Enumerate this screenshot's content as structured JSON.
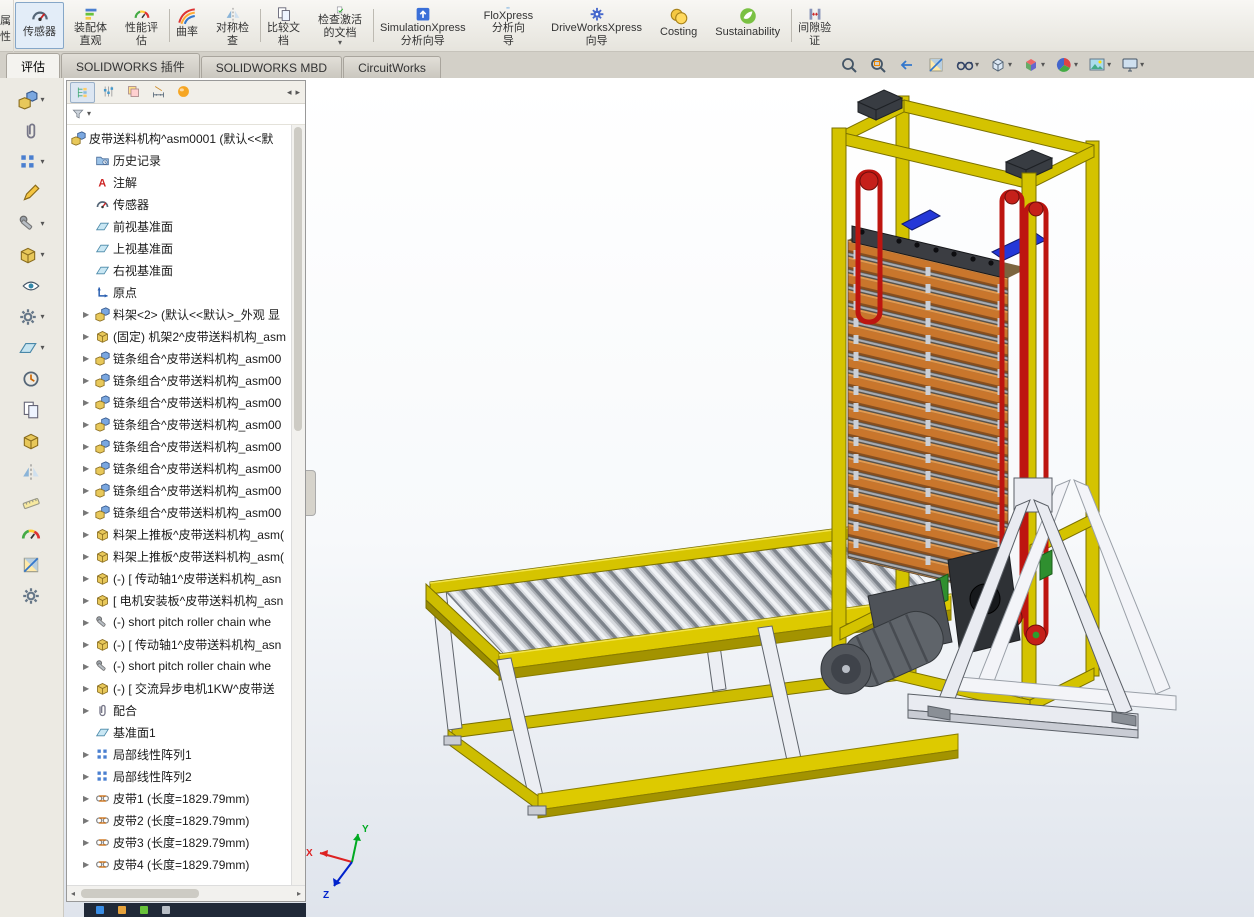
{
  "colors": {
    "frame_yellow": "#d4c300",
    "tray_orange": "#c9762c",
    "chain_red": "#bd1510",
    "accent_blue": "#2438d8",
    "roller_silver": "#d6d9de",
    "support_white": "#e9ebf1",
    "motor_gray": "#5f646a",
    "tensioner_green": "#2f8f2f"
  },
  "top_toolbar": {
    "clipped": {
      "label": "属\n性"
    },
    "buttons": [
      {
        "name": "sensors-button",
        "label": "传感器",
        "icon": "#s-sensor",
        "pressed": true
      },
      {
        "name": "assembly-visualization-button",
        "label": "装配体\n直观",
        "icon": "#s-visual"
      },
      {
        "name": "performance-evaluation-button",
        "label": "性能评\n估",
        "icon": "#s-perf",
        "sep": true
      },
      {
        "name": "curvature-button",
        "label": "曲率",
        "icon": "#s-curv"
      },
      {
        "name": "symmetry-check-button",
        "label": "对称检\n查",
        "icon": "#s-symm",
        "sep": true
      },
      {
        "name": "compare-documents-button",
        "label": "比较文\n档",
        "icon": "#s-cmpdoc"
      },
      {
        "name": "check-active-document-button",
        "label": "检查激活\n的文档",
        "icon": "#s-checkdoc",
        "dd": "▾",
        "sep": true
      },
      {
        "name": "simulationxpress-button",
        "label": "SimulationXpress\n分析向导",
        "icon": "#s-simx"
      },
      {
        "name": "floxpress-button",
        "label": "FloXpress\n分析向\n导",
        "icon": "#s-flox"
      },
      {
        "name": "driveworksxpress-button",
        "label": "DriveWorksXpress\n向导",
        "icon": "#s-dwx"
      },
      {
        "name": "costing-button",
        "label": "Costing",
        "icon": "#s-cost"
      },
      {
        "name": "sustainability-button",
        "label": "Sustainability",
        "icon": "#s-sust",
        "sep": true
      },
      {
        "name": "clearance-verification-button",
        "label": "间隙验\n证",
        "icon": "#s-gap"
      }
    ]
  },
  "tabs": {
    "items": [
      {
        "name": "tab-evaluate",
        "label": "评估",
        "active": true
      },
      {
        "name": "tab-solidworks-addins",
        "label": "SOLIDWORKS 插件"
      },
      {
        "name": "tab-solidworks-mbd",
        "label": "SOLIDWORKS MBD"
      },
      {
        "name": "tab-circuitworks",
        "label": "CircuitWorks"
      }
    ]
  },
  "hud": {
    "buttons": [
      {
        "name": "zoom-to-fit-button",
        "icon": "#s-zoomfit"
      },
      {
        "name": "zoom-to-area-button",
        "icon": "#s-zoomarea"
      },
      {
        "name": "previous-view-button",
        "icon": "#s-prev"
      },
      {
        "name": "section-view-button",
        "icon": "#s-section"
      },
      {
        "name": "hide-show-items-button",
        "icon": "#s-glasses",
        "dd": "▾"
      },
      {
        "name": "display-style-button",
        "icon": "#s-dispstyle",
        "dd": "▾"
      },
      {
        "name": "view-orientation-button",
        "icon": "#s-vieworient",
        "dd": "▾"
      },
      {
        "name": "edit-appearance-button",
        "icon": "#s-appearance",
        "dd": "▾"
      },
      {
        "name": "apply-scene-button",
        "icon": "#s-scene",
        "dd": "▾"
      },
      {
        "name": "view-settings-button",
        "icon": "#s-monitor",
        "dd": "▾"
      }
    ]
  },
  "left_toolbar": {
    "buttons": [
      {
        "name": "insert-components-button",
        "icon": "#s-cubes",
        "dd": "▾"
      },
      {
        "name": "mate-button",
        "icon": "#s-clip"
      },
      {
        "name": "linear-component-pattern-button",
        "icon": "#s-grid",
        "dd": "▾"
      },
      {
        "name": "edit-component-button",
        "icon": "#s-pencil"
      },
      {
        "name": "smart-fasteners-button",
        "icon": "#s-bolt",
        "dd": "▾"
      },
      {
        "name": "move-component-button",
        "icon": "#s-cube",
        "dd": "▾"
      },
      {
        "name": "show-hidden-components-button",
        "icon": "#s-eye"
      },
      {
        "name": "assembly-features-button",
        "icon": "#s-gear",
        "dd": "▾"
      },
      {
        "name": "reference-geometry-button",
        "icon": "#s-plane",
        "dd": "▾"
      },
      {
        "name": "new-motion-study-button",
        "icon": "#s-motion"
      },
      {
        "name": "bill-of-materials-button",
        "icon": "#s-cmpdoc"
      },
      {
        "name": "exploded-view-button",
        "icon": "#s-cube"
      },
      {
        "name": "interference-detection-button",
        "icon": "#s-symm"
      },
      {
        "name": "measure-button",
        "icon": "#s-ruler"
      },
      {
        "name": "mass-properties-button",
        "icon": "#s-perf"
      },
      {
        "name": "section-properties-button",
        "icon": "#s-section"
      },
      {
        "name": "options-button",
        "icon": "#s-gear"
      }
    ]
  },
  "manager": {
    "tabs": [
      {
        "name": "featuremanager-tab",
        "icon": "#s-fmtree",
        "sel": true
      },
      {
        "name": "propertymanager-tab",
        "icon": "#s-props"
      },
      {
        "name": "configurationmanager-tab",
        "icon": "#s-config"
      },
      {
        "name": "dimxpertmanager-tab",
        "icon": "#s-dimx"
      },
      {
        "name": "displaymanager-tab",
        "icon": "#s-dispmgr"
      }
    ],
    "nav": {
      "left": "◂",
      "right": "▸"
    },
    "filter": {
      "dd": "▾"
    },
    "root": {
      "label": "皮带送料机构^asm0001 (默认<<默",
      "icon": "#s-cubes"
    },
    "items": [
      {
        "label": "历史记录",
        "icon": "#s-folder"
      },
      {
        "label": "注解",
        "icon": "#s-annot"
      },
      {
        "label": "传感器",
        "icon": "#s-sensor"
      },
      {
        "label": "前视基准面",
        "icon": "#s-plane"
      },
      {
        "label": "上视基准面",
        "icon": "#s-plane"
      },
      {
        "label": "右视基准面",
        "icon": "#s-plane"
      },
      {
        "label": "原点",
        "icon": "#s-origin"
      },
      {
        "label": "料架<2> (默认<<默认>_外观 显",
        "icon": "#s-cubes",
        "arrow": "▶"
      },
      {
        "label": "(固定) 机架2^皮带送料机构_asm",
        "icon": "#s-cube",
        "arrow": "▶"
      },
      {
        "label": "链条组合^皮带送料机构_asm00",
        "icon": "#s-cubes",
        "arrow": "▶"
      },
      {
        "label": "链条组合^皮带送料机构_asm00",
        "icon": "#s-cubes",
        "arrow": "▶"
      },
      {
        "label": "链条组合^皮带送料机构_asm00",
        "icon": "#s-cubes",
        "arrow": "▶"
      },
      {
        "label": "链条组合^皮带送料机构_asm00",
        "icon": "#s-cubes",
        "arrow": "▶"
      },
      {
        "label": "链条组合^皮带送料机构_asm00",
        "icon": "#s-cubes",
        "arrow": "▶"
      },
      {
        "label": "链条组合^皮带送料机构_asm00",
        "icon": "#s-cubes",
        "arrow": "▶"
      },
      {
        "label": "链条组合^皮带送料机构_asm00",
        "icon": "#s-cubes",
        "arrow": "▶"
      },
      {
        "label": "链条组合^皮带送料机构_asm00",
        "icon": "#s-cubes",
        "arrow": "▶"
      },
      {
        "label": "料架上推板^皮带送料机构_asm(",
        "icon": "#s-cube",
        "arrow": "▶"
      },
      {
        "label": "料架上推板^皮带送料机构_asm(",
        "icon": "#s-cube",
        "arrow": "▶"
      },
      {
        "label": "(-) [ 传动轴1^皮带送料机构_asn",
        "icon": "#s-cube",
        "arrow": "▶"
      },
      {
        "label": "[ 电机安装板^皮带送料机构_asn",
        "icon": "#s-cube",
        "arrow": "▶"
      },
      {
        "label": "(-) short pitch roller chain whe",
        "icon": "#s-bolt",
        "arrow": "▶"
      },
      {
        "label": "(-) [ 传动轴1^皮带送料机构_asn",
        "icon": "#s-cube",
        "arrow": "▶"
      },
      {
        "label": "(-) short pitch roller chain whe",
        "icon": "#s-bolt",
        "arrow": "▶"
      },
      {
        "label": "(-) [ 交流异步电机1KW^皮带送",
        "icon": "#s-cube",
        "arrow": "▶"
      },
      {
        "label": "配合",
        "icon": "#s-clip",
        "arrow": "▶"
      },
      {
        "label": "基准面1",
        "icon": "#s-plane"
      },
      {
        "label": "局部线性阵列1",
        "icon": "#s-grid",
        "arrow": "▶"
      },
      {
        "label": "局部线性阵列2",
        "icon": "#s-grid",
        "arrow": "▶"
      },
      {
        "label": "皮带1 (长度=1829.79mm)",
        "icon": "#s-belt",
        "arrow": "▶"
      },
      {
        "label": "皮带2 (长度=1829.79mm)",
        "icon": "#s-belt",
        "arrow": "▶"
      },
      {
        "label": "皮带3 (长度=1829.79mm)",
        "icon": "#s-belt",
        "arrow": "▶"
      },
      {
        "label": "皮带4 (长度=1829.79mm)",
        "icon": "#s-belt",
        "arrow": "▶"
      }
    ],
    "hscroll": {
      "left": "◂",
      "right": "▸"
    }
  },
  "triad": {
    "x": "X",
    "y": "Y",
    "z": "Z"
  }
}
